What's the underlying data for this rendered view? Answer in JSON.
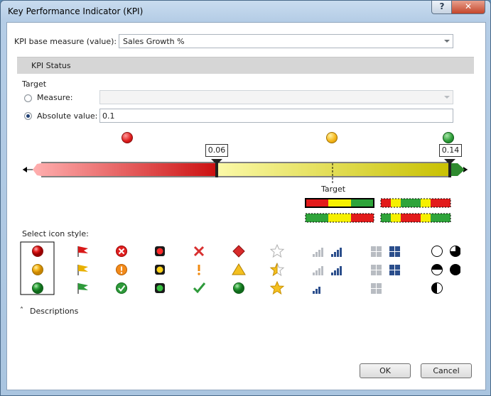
{
  "window": {
    "title": "Key Performance Indicator (KPI)",
    "help_label": "?",
    "close_label": "✕"
  },
  "base_measure": {
    "label": "KPI base measure (value):",
    "value": "Sales Growth %"
  },
  "kpi_status": {
    "header": "KPI Status"
  },
  "target": {
    "group_label": "Target",
    "measure_label": "Measure:",
    "measure_value": "",
    "absolute_label": "Absolute value:",
    "absolute_value": "0.1",
    "selected": "absolute"
  },
  "slider": {
    "low_threshold": "0.06",
    "high_threshold": "0.14",
    "target_label": "Target",
    "colors": {
      "red": "#d81818",
      "yellow": "#f5f08c",
      "green": "#2e9a3a"
    }
  },
  "icon_style": {
    "label": "Select icon style:",
    "styles": [
      "traffic-circles",
      "flags",
      "symbol-circles",
      "traffic-lights",
      "symbols",
      "shapes",
      "stars",
      "signal-bars",
      "quadrant-squares",
      "pie-circles"
    ],
    "selected": "traffic-circles"
  },
  "descriptions": {
    "label": "Descriptions"
  },
  "buttons": {
    "ok": "OK",
    "cancel": "Cancel"
  }
}
